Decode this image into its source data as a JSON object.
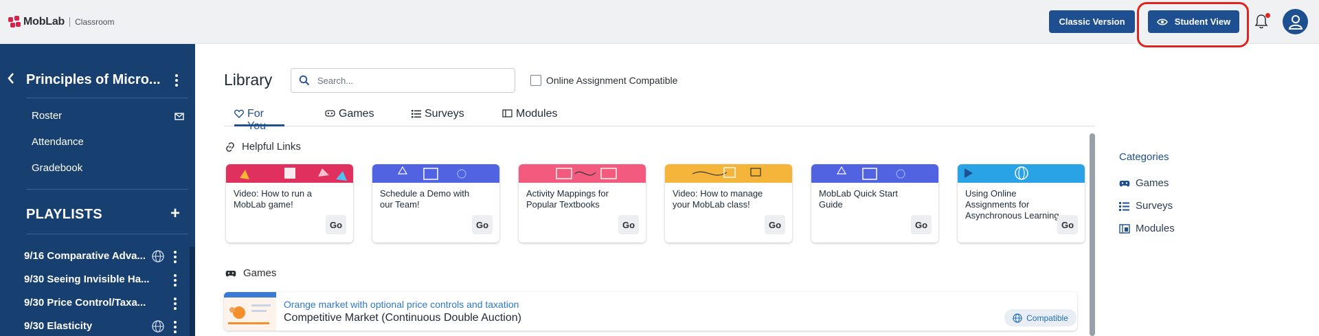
{
  "header": {
    "logo_text": "MobLab",
    "logo_sub": "Classroom",
    "classic_button": "Classic Version",
    "student_view_button": "Student View"
  },
  "sidebar": {
    "course_title": "Principles of Micro...",
    "links": [
      "Roster",
      "Attendance",
      "Gradebook"
    ],
    "playlists_heading": "PLAYLISTS",
    "add_symbol": "+",
    "playlists": [
      {
        "label": "9/16 Comparative Adva...",
        "shared": true
      },
      {
        "label": "9/30 Seeing Invisible Ha...",
        "shared": false
      },
      {
        "label": "9/30 Price Control/Taxa...",
        "shared": false
      },
      {
        "label": "9/30 Elasticity",
        "shared": true
      }
    ]
  },
  "library": {
    "title": "Library",
    "search_placeholder": "Search...",
    "online_compatible_label": "Online Assignment Compatible",
    "online_compatible_checked": false,
    "tabs": [
      {
        "label": "For You",
        "icon": "heart-icon",
        "active": true
      },
      {
        "label": "Games",
        "icon": "gamepad-icon",
        "active": false
      },
      {
        "label": "Surveys",
        "icon": "list-icon",
        "active": false
      },
      {
        "label": "Modules",
        "icon": "module-icon",
        "active": false
      }
    ],
    "helpful_links_heading": "Helpful Links",
    "go_label": "Go",
    "cards": [
      {
        "text": "Video: How to run a MobLab game!",
        "banner_color": "#e0305e"
      },
      {
        "text": "Schedule a Demo with our Team!",
        "banner_color": "#5163e0"
      },
      {
        "text": "Activity Mappings for Popular Textbooks",
        "banner_color": "#f25a7e"
      },
      {
        "text": "Video: How to manage your MobLab class!",
        "banner_color": "#f5b53a"
      },
      {
        "text": "MobLab Quick Start Guide",
        "banner_color": "#5163e0"
      },
      {
        "text": "Using Online Assignments for Asynchronous Learning",
        "banner_color": "#2aa3e6"
      }
    ],
    "games_heading": "Games",
    "game": {
      "subtitle": "Orange market with optional price controls and taxation",
      "title": "Competitive Market (Continuous Double Auction)",
      "badge": "Compatible"
    }
  },
  "categories": {
    "title": "Categories",
    "items": [
      {
        "label": "Games",
        "icon": "gamepad-icon"
      },
      {
        "label": "Surveys",
        "icon": "list-icon"
      },
      {
        "label": "Modules",
        "icon": "module-icon"
      }
    ]
  },
  "colors": {
    "primary": "#1d4f91",
    "sidebar": "#173f70",
    "highlight": "#e0231e",
    "link": "#2f79c4"
  }
}
